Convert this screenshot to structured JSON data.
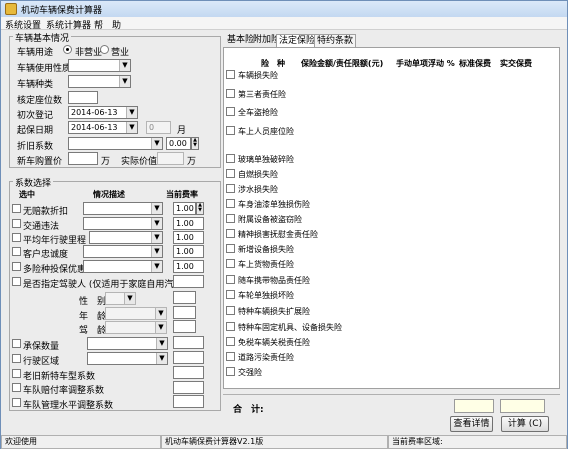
{
  "window": {
    "title": "机动车辆保费计算器"
  },
  "menu": [
    "系统设置",
    "系统计算器",
    "帮　助"
  ],
  "vehicle_info": {
    "group_title": "车辆基本情况",
    "usage_label": "车辆用途",
    "usage_options": [
      "非营业",
      "营业"
    ],
    "usage_selected": "非营业",
    "nature_label": "车辆使用性质",
    "type_label": "车辆种类",
    "seats_label": "核定座位数",
    "first_reg_label": "初次登记",
    "first_reg_value": "2014-06-13",
    "start_date_label": "起保日期",
    "start_date_value": "2014-06-13",
    "months_value": "0",
    "months_unit": "月",
    "depreciation_label": "折旧系数",
    "depreciation_value": "0.00",
    "new_price_label": "新车购置价",
    "new_price_unit": "万",
    "actual_value_label": "实际价值",
    "actual_value_unit": "万"
  },
  "coefficients": {
    "group_title": "系数选择",
    "headers": {
      "select": "选中",
      "desc": "情况描述",
      "rate": "当前费率"
    },
    "rows": [
      {
        "label": "无赔款折扣",
        "rate": "1.00"
      },
      {
        "label": "交通违法",
        "rate": "1.00"
      },
      {
        "label": "平均年行驶里程",
        "rate": "1.00"
      },
      {
        "label": "客户忠诚度",
        "rate": "1.00"
      },
      {
        "label": "多险种投保优惠",
        "rate": "1.00"
      }
    ],
    "driver_label": "是否指定驾驶人 (仅适用于家庭自用汽车)",
    "driver_fields": [
      "性　别",
      "年　龄",
      "驾　龄"
    ],
    "other_rows": [
      "承保数量",
      "行驶区域",
      "老旧新特车型系数",
      "车队赔付率调整系数",
      "车队管理水平调整系数"
    ]
  },
  "tabs": [
    "基本险",
    "附加险",
    "法定保险",
    "特约条款"
  ],
  "tab_selected": "法定保险",
  "table_headers": [
    "险　种",
    "保险金额/责任限额(元)",
    "手动单项浮动 %",
    "标准保费",
    "实交保费"
  ],
  "basic_insurance": [
    "车辆损失险",
    "第三者责任险",
    "全车盗抢险",
    "车上人员座位险"
  ],
  "additional_insurance": [
    "玻璃单独破碎险",
    "自燃损失险",
    "涉水损失险",
    "车身油漆单独损伤险",
    "附属设备被盗窃险",
    "精神损害抚慰金责任险",
    "新增设备损失险",
    "车上货物责任险",
    "随车携带物品责任险",
    "车轮单独损坏险",
    "特种车辆损失扩展险",
    "特种车固定机具、设备损失险",
    "免税车辆关税责任险",
    "道路污染责任险",
    "交强险"
  ],
  "total_label": "合　计:",
  "buttons": {
    "details": "查看详情",
    "calculate": "计算 (C)"
  },
  "status_bar": [
    "欢迎使用",
    "机动车辆保费计算器V2.1版",
    "当前费率区域:"
  ]
}
